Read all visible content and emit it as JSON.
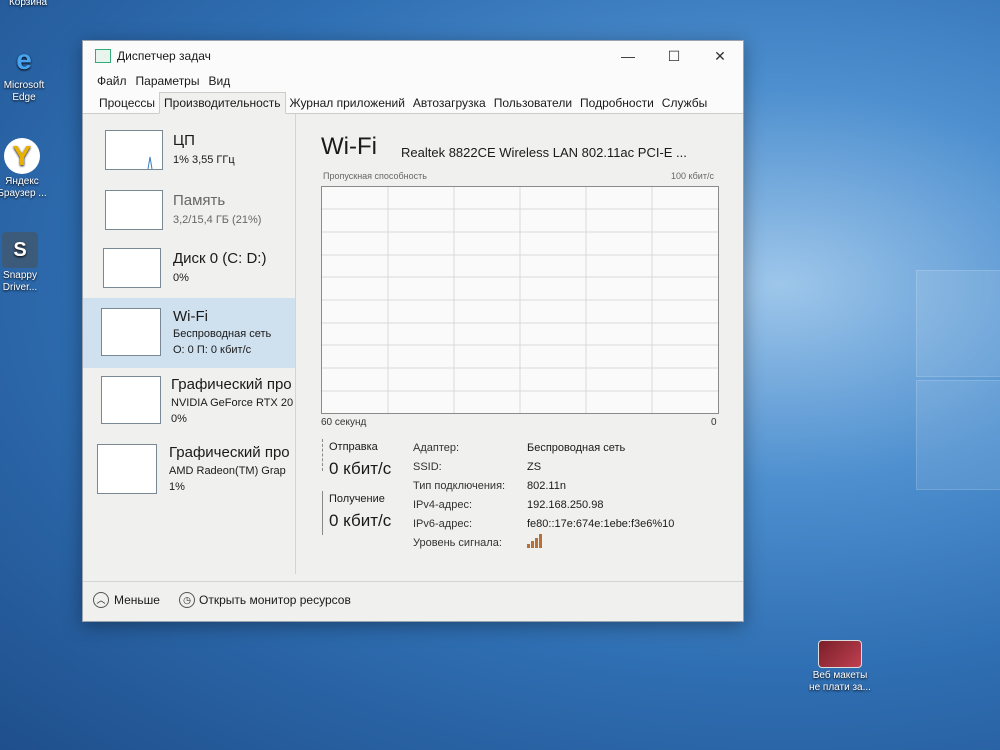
{
  "desktop": {
    "top_label": "Корзина",
    "icons": [
      {
        "label_line1": "Microsoft",
        "label_line2": "Edge",
        "glyph": "e"
      },
      {
        "label_line1": "Яндекс",
        "label_line2": "Браузер ...",
        "glyph": "Y"
      },
      {
        "label_line1": "Snappy",
        "label_line2": "Driver...",
        "glyph": "S"
      }
    ],
    "bottom_icon": {
      "label_line1": "Веб макеты",
      "label_line2": "не плати за..."
    }
  },
  "window": {
    "title": "Диспетчер задач",
    "controls": {
      "minimize": "—",
      "maximize": "☐",
      "close": "✕"
    },
    "menu": [
      "Файл",
      "Параметры",
      "Вид"
    ],
    "tabs": [
      "Процессы",
      "Производительность",
      "Журнал приложений",
      "Автозагрузка",
      "Пользователи",
      "Подробности",
      "Службы"
    ],
    "active_tab": "Производительность"
  },
  "sidebar": {
    "items": [
      {
        "title": "ЦП",
        "line1": "1% 3,55 ГГц",
        "line2": ""
      },
      {
        "title": "Память",
        "line1": "3,2/15,4 ГБ (21%)",
        "line2": ""
      },
      {
        "title": "Диск 0 (C: D:)",
        "line1": "0%",
        "line2": ""
      },
      {
        "title": "Wi-Fi",
        "line1": "Беспроводная сеть",
        "line2": "О: 0 П: 0 кбит/с"
      },
      {
        "title": "Графический про",
        "line1": "NVIDIA GeForce RTX 20",
        "line2": "0%"
      },
      {
        "title": "Графический про",
        "line1": "AMD Radeon(TM) Grap",
        "line2": "1%"
      }
    ],
    "active_index": 3
  },
  "main": {
    "title": "Wi-Fi",
    "device": "Realtek 8822CE Wireless LAN 802.11ac PCI-E ...",
    "graph_label": "Пропускная способность",
    "graph_max": "100 кбит/с",
    "graph_time": "60 секунд",
    "graph_min": "0",
    "send_label": "Отправка",
    "send_value": "0 кбит/с",
    "recv_label": "Получение",
    "recv_value": "0 кбит/с",
    "info": [
      {
        "key": "Адаптер:",
        "value": "Беспроводная сеть"
      },
      {
        "key": "SSID:",
        "value": "ZS"
      },
      {
        "key": "Тип подключения:",
        "value": "802.11n"
      },
      {
        "key": "IPv4-адрес:",
        "value": "192.168.250.98"
      },
      {
        "key": "IPv6-адрес:",
        "value": "fe80::17e:674e:1ebe:f3e6%10"
      },
      {
        "key": "Уровень сигнала:",
        "value": ""
      }
    ],
    "signal_bars": 4
  },
  "footer": {
    "less_label": "Меньше",
    "monitor_label": "Открыть монитор ресурсов"
  },
  "colors": {
    "accent": "#cfe0ef",
    "signal": "#b8703a"
  }
}
